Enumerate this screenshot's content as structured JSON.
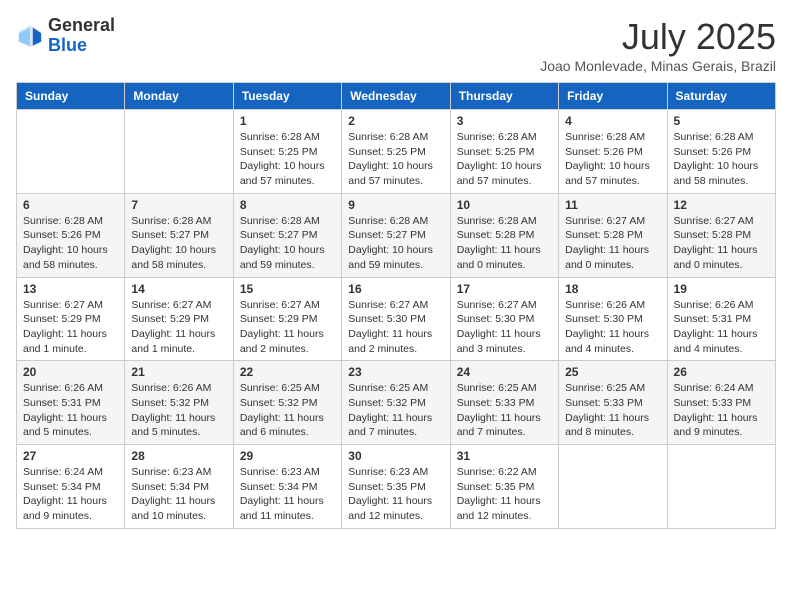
{
  "header": {
    "logo_general": "General",
    "logo_blue": "Blue",
    "month_title": "July 2025",
    "location": "Joao Monlevade, Minas Gerais, Brazil"
  },
  "weekdays": [
    "Sunday",
    "Monday",
    "Tuesday",
    "Wednesday",
    "Thursday",
    "Friday",
    "Saturday"
  ],
  "weeks": [
    [
      {
        "day": "",
        "sunrise": "",
        "sunset": "",
        "daylight": ""
      },
      {
        "day": "",
        "sunrise": "",
        "sunset": "",
        "daylight": ""
      },
      {
        "day": "1",
        "sunrise": "Sunrise: 6:28 AM",
        "sunset": "Sunset: 5:25 PM",
        "daylight": "Daylight: 10 hours and 57 minutes."
      },
      {
        "day": "2",
        "sunrise": "Sunrise: 6:28 AM",
        "sunset": "Sunset: 5:25 PM",
        "daylight": "Daylight: 10 hours and 57 minutes."
      },
      {
        "day": "3",
        "sunrise": "Sunrise: 6:28 AM",
        "sunset": "Sunset: 5:25 PM",
        "daylight": "Daylight: 10 hours and 57 minutes."
      },
      {
        "day": "4",
        "sunrise": "Sunrise: 6:28 AM",
        "sunset": "Sunset: 5:26 PM",
        "daylight": "Daylight: 10 hours and 57 minutes."
      },
      {
        "day": "5",
        "sunrise": "Sunrise: 6:28 AM",
        "sunset": "Sunset: 5:26 PM",
        "daylight": "Daylight: 10 hours and 58 minutes."
      }
    ],
    [
      {
        "day": "6",
        "sunrise": "Sunrise: 6:28 AM",
        "sunset": "Sunset: 5:26 PM",
        "daylight": "Daylight: 10 hours and 58 minutes."
      },
      {
        "day": "7",
        "sunrise": "Sunrise: 6:28 AM",
        "sunset": "Sunset: 5:27 PM",
        "daylight": "Daylight: 10 hours and 58 minutes."
      },
      {
        "day": "8",
        "sunrise": "Sunrise: 6:28 AM",
        "sunset": "Sunset: 5:27 PM",
        "daylight": "Daylight: 10 hours and 59 minutes."
      },
      {
        "day": "9",
        "sunrise": "Sunrise: 6:28 AM",
        "sunset": "Sunset: 5:27 PM",
        "daylight": "Daylight: 10 hours and 59 minutes."
      },
      {
        "day": "10",
        "sunrise": "Sunrise: 6:28 AM",
        "sunset": "Sunset: 5:28 PM",
        "daylight": "Daylight: 11 hours and 0 minutes."
      },
      {
        "day": "11",
        "sunrise": "Sunrise: 6:27 AM",
        "sunset": "Sunset: 5:28 PM",
        "daylight": "Daylight: 11 hours and 0 minutes."
      },
      {
        "day": "12",
        "sunrise": "Sunrise: 6:27 AM",
        "sunset": "Sunset: 5:28 PM",
        "daylight": "Daylight: 11 hours and 0 minutes."
      }
    ],
    [
      {
        "day": "13",
        "sunrise": "Sunrise: 6:27 AM",
        "sunset": "Sunset: 5:29 PM",
        "daylight": "Daylight: 11 hours and 1 minute."
      },
      {
        "day": "14",
        "sunrise": "Sunrise: 6:27 AM",
        "sunset": "Sunset: 5:29 PM",
        "daylight": "Daylight: 11 hours and 1 minute."
      },
      {
        "day": "15",
        "sunrise": "Sunrise: 6:27 AM",
        "sunset": "Sunset: 5:29 PM",
        "daylight": "Daylight: 11 hours and 2 minutes."
      },
      {
        "day": "16",
        "sunrise": "Sunrise: 6:27 AM",
        "sunset": "Sunset: 5:30 PM",
        "daylight": "Daylight: 11 hours and 2 minutes."
      },
      {
        "day": "17",
        "sunrise": "Sunrise: 6:27 AM",
        "sunset": "Sunset: 5:30 PM",
        "daylight": "Daylight: 11 hours and 3 minutes."
      },
      {
        "day": "18",
        "sunrise": "Sunrise: 6:26 AM",
        "sunset": "Sunset: 5:30 PM",
        "daylight": "Daylight: 11 hours and 4 minutes."
      },
      {
        "day": "19",
        "sunrise": "Sunrise: 6:26 AM",
        "sunset": "Sunset: 5:31 PM",
        "daylight": "Daylight: 11 hours and 4 minutes."
      }
    ],
    [
      {
        "day": "20",
        "sunrise": "Sunrise: 6:26 AM",
        "sunset": "Sunset: 5:31 PM",
        "daylight": "Daylight: 11 hours and 5 minutes."
      },
      {
        "day": "21",
        "sunrise": "Sunrise: 6:26 AM",
        "sunset": "Sunset: 5:32 PM",
        "daylight": "Daylight: 11 hours and 5 minutes."
      },
      {
        "day": "22",
        "sunrise": "Sunrise: 6:25 AM",
        "sunset": "Sunset: 5:32 PM",
        "daylight": "Daylight: 11 hours and 6 minutes."
      },
      {
        "day": "23",
        "sunrise": "Sunrise: 6:25 AM",
        "sunset": "Sunset: 5:32 PM",
        "daylight": "Daylight: 11 hours and 7 minutes."
      },
      {
        "day": "24",
        "sunrise": "Sunrise: 6:25 AM",
        "sunset": "Sunset: 5:33 PM",
        "daylight": "Daylight: 11 hours and 7 minutes."
      },
      {
        "day": "25",
        "sunrise": "Sunrise: 6:25 AM",
        "sunset": "Sunset: 5:33 PM",
        "daylight": "Daylight: 11 hours and 8 minutes."
      },
      {
        "day": "26",
        "sunrise": "Sunrise: 6:24 AM",
        "sunset": "Sunset: 5:33 PM",
        "daylight": "Daylight: 11 hours and 9 minutes."
      }
    ],
    [
      {
        "day": "27",
        "sunrise": "Sunrise: 6:24 AM",
        "sunset": "Sunset: 5:34 PM",
        "daylight": "Daylight: 11 hours and 9 minutes."
      },
      {
        "day": "28",
        "sunrise": "Sunrise: 6:23 AM",
        "sunset": "Sunset: 5:34 PM",
        "daylight": "Daylight: 11 hours and 10 minutes."
      },
      {
        "day": "29",
        "sunrise": "Sunrise: 6:23 AM",
        "sunset": "Sunset: 5:34 PM",
        "daylight": "Daylight: 11 hours and 11 minutes."
      },
      {
        "day": "30",
        "sunrise": "Sunrise: 6:23 AM",
        "sunset": "Sunset: 5:35 PM",
        "daylight": "Daylight: 11 hours and 12 minutes."
      },
      {
        "day": "31",
        "sunrise": "Sunrise: 6:22 AM",
        "sunset": "Sunset: 5:35 PM",
        "daylight": "Daylight: 11 hours and 12 minutes."
      },
      {
        "day": "",
        "sunrise": "",
        "sunset": "",
        "daylight": ""
      },
      {
        "day": "",
        "sunrise": "",
        "sunset": "",
        "daylight": ""
      }
    ]
  ]
}
